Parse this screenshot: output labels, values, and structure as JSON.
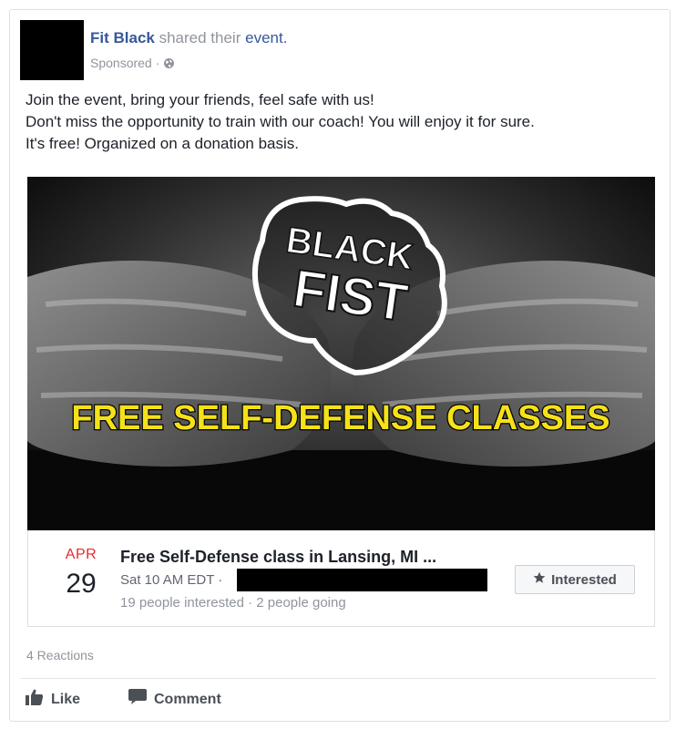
{
  "post": {
    "page_name": "Fit Black",
    "shared_text": "shared their",
    "event_word": "event.",
    "sponsored": "Sponsored",
    "separator": "·",
    "text_lines": [
      "Join the event, bring your friends, feel safe with us!",
      "Don't miss the opportunity to train with our coach! You will enjoy it for sure.",
      "It's free! Organized on a donation basis."
    ]
  },
  "banner": {
    "logo_line1": "BLACK",
    "logo_line2": "FIST",
    "headline": "FREE SELF-DEFENSE CLASSES",
    "headline_color": "#f5e11a"
  },
  "event": {
    "month": "APR",
    "day": "29",
    "title": "Free Self-Defense class in Lansing, MI ...",
    "time": "Sat 10 AM EDT ·",
    "stats": "19 people interested · 2 people going",
    "interested_label": "Interested"
  },
  "footer": {
    "reactions": "4 Reactions",
    "like_label": "Like",
    "comment_label": "Comment"
  },
  "colors": {
    "link": "#365899",
    "month": "#e9282d",
    "muted": "#90949c"
  },
  "icons": [
    "globe-icon",
    "star-icon",
    "like-icon",
    "comment-icon"
  ]
}
